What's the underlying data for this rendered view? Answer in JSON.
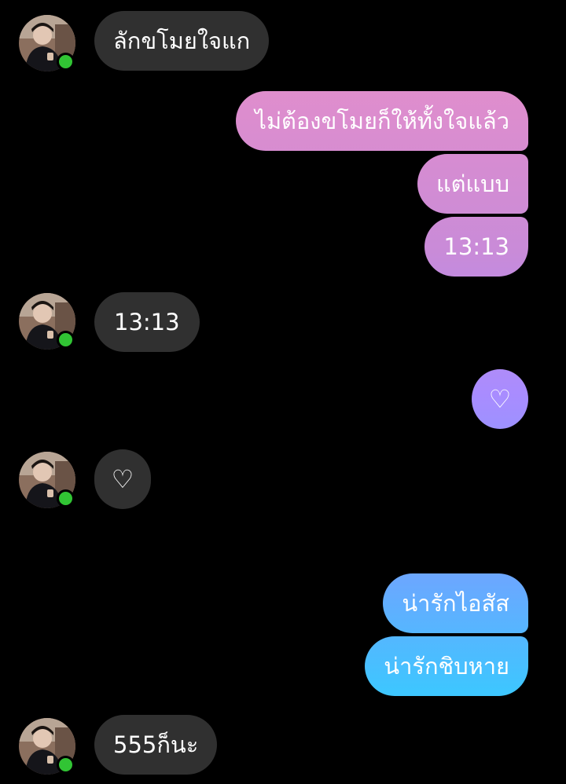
{
  "colors": {
    "background": "#000000",
    "incoming_bubble": "#303030",
    "outgoing_gradient_top": "#ec8fc6",
    "outgoing_gradient_bottom": "#3ec6ff",
    "online_indicator": "#31c434"
  },
  "messages": [
    {
      "direction": "incoming",
      "text": "ลักขโมยใจแก",
      "avatar": true
    },
    {
      "direction": "outgoing",
      "text": "ไม่ต้องขโมยก็ให้ทั้งใจแล้ว"
    },
    {
      "direction": "outgoing",
      "text": "แต่แบบ"
    },
    {
      "direction": "outgoing",
      "text": "13:13"
    },
    {
      "direction": "incoming",
      "text": "13:13",
      "avatar": true
    },
    {
      "direction": "outgoing",
      "text": "♡"
    },
    {
      "direction": "incoming",
      "text": "♡",
      "avatar": true
    },
    {
      "direction": "outgoing",
      "text": "น่ารักไอสัส"
    },
    {
      "direction": "outgoing",
      "text": "น่ารักชิบหาย"
    },
    {
      "direction": "incoming",
      "text": "555ก็นะ",
      "avatar": true
    }
  ]
}
